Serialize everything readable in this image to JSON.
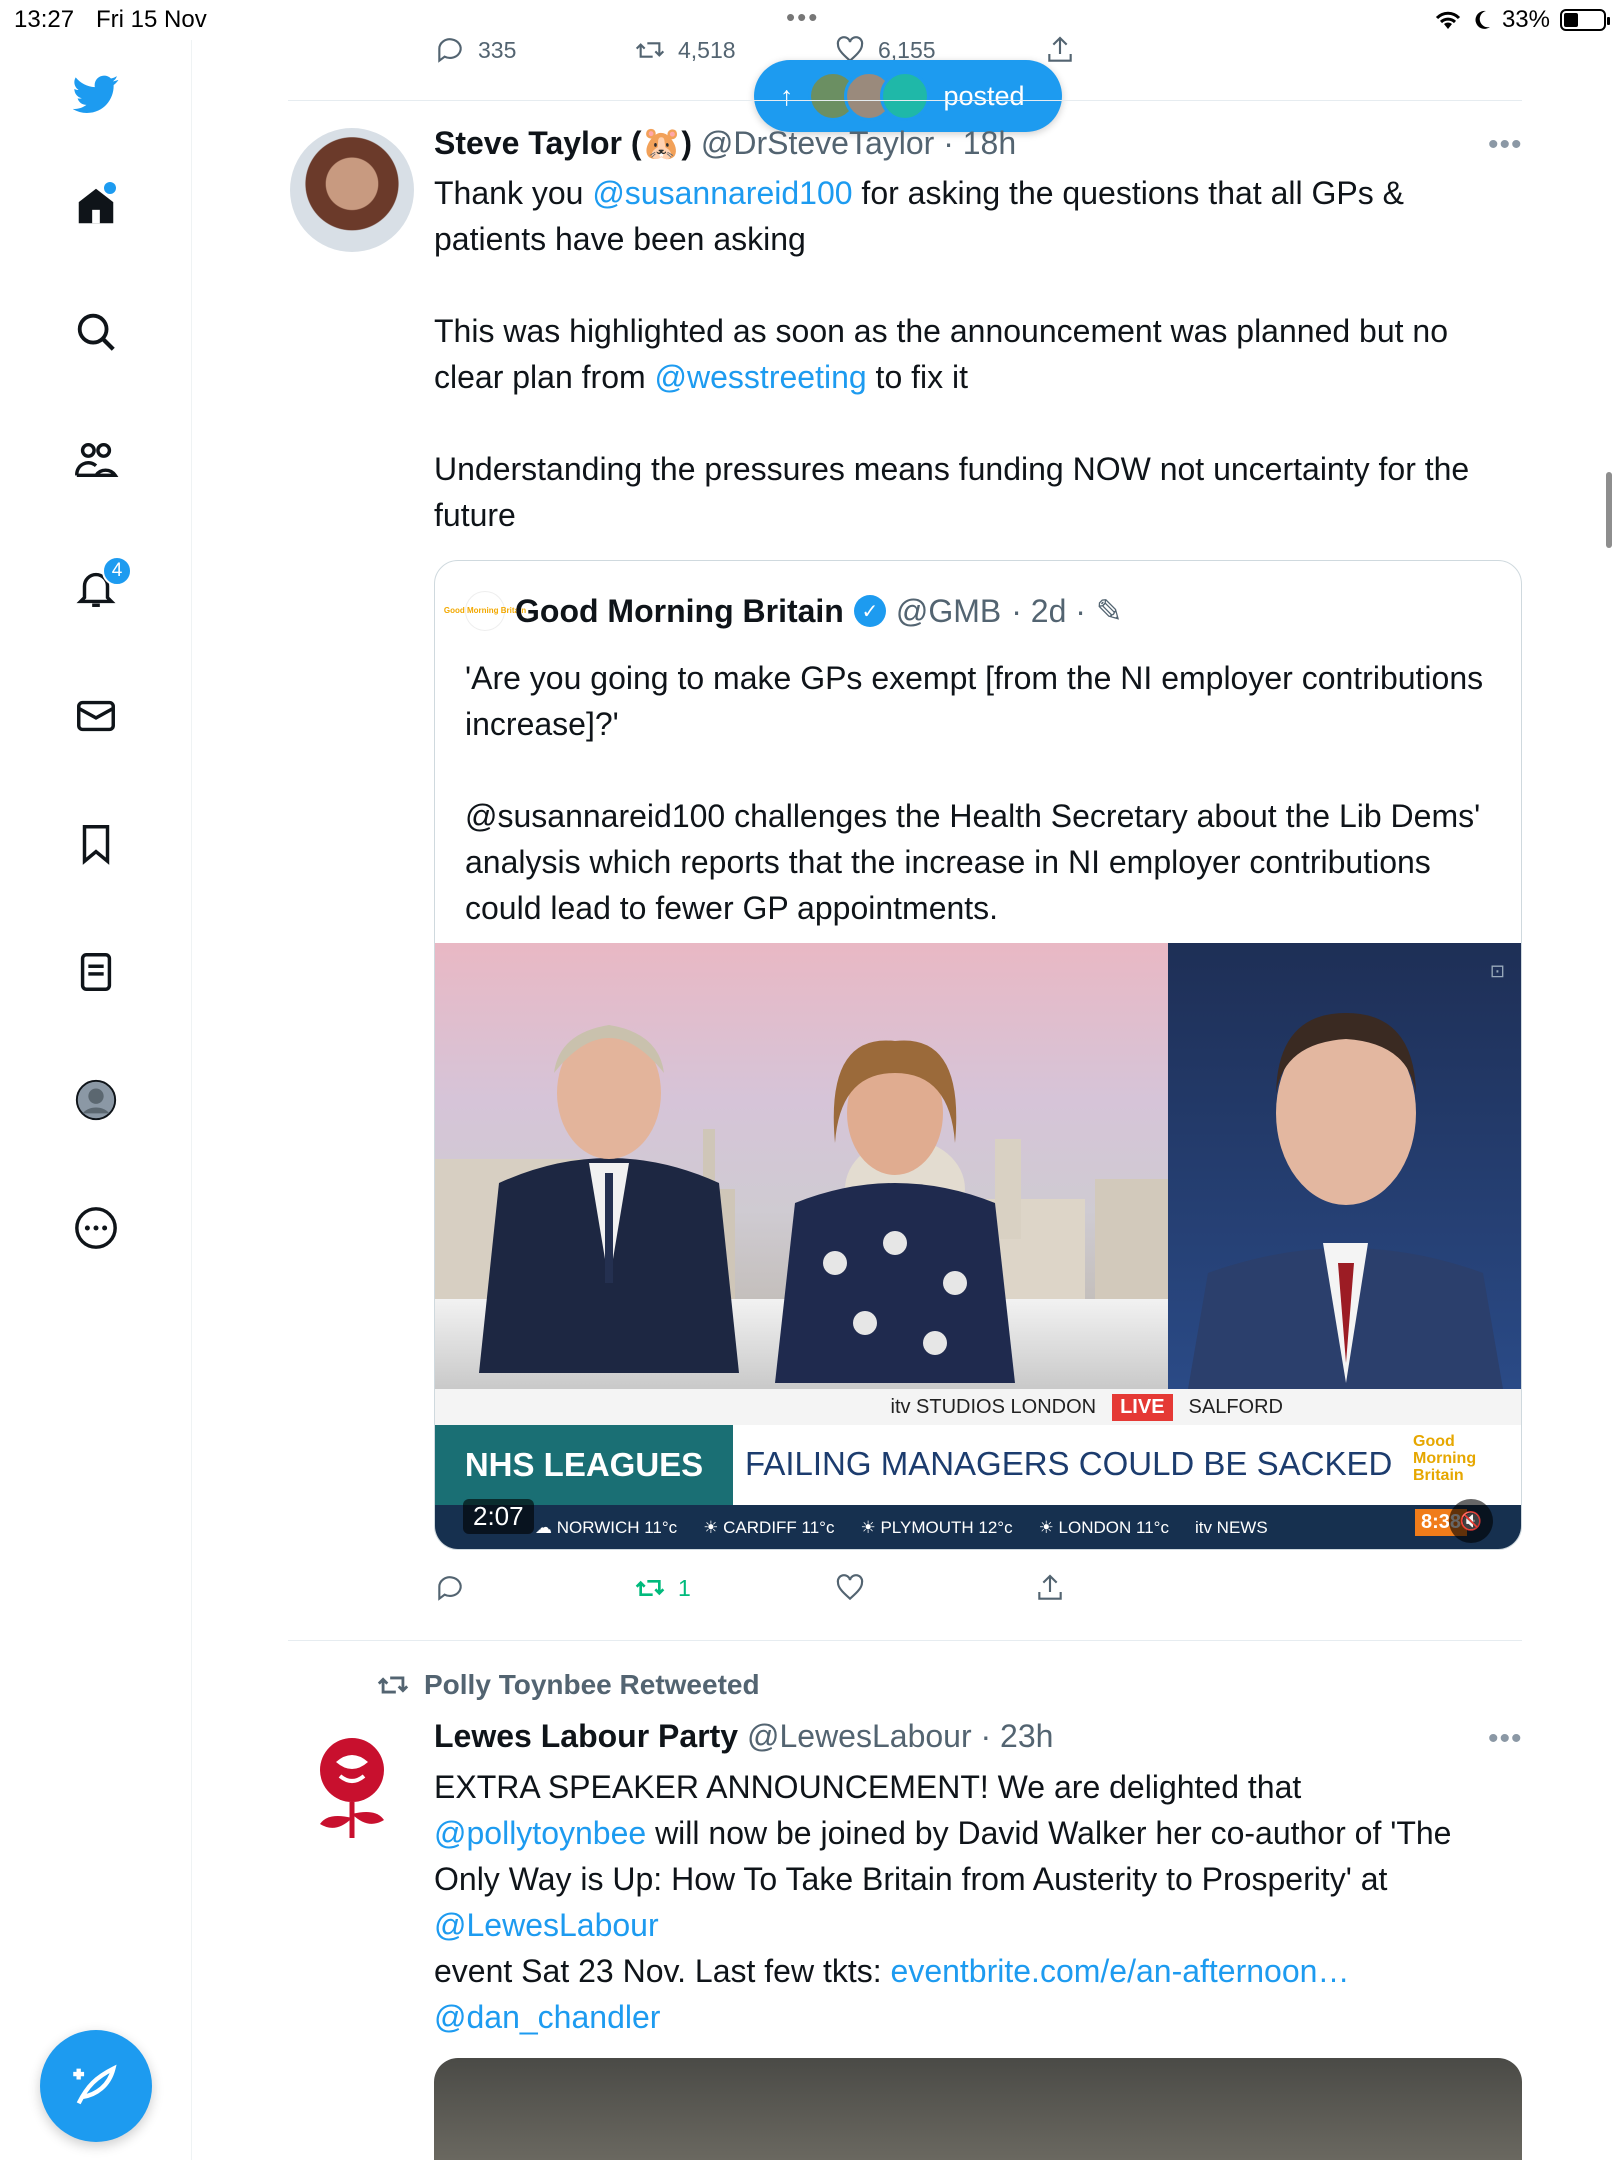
{
  "status_bar": {
    "time": "13:27",
    "date": "Fri 15 Nov",
    "battery": "33%",
    "battery_level": 0.33
  },
  "top_actions": {
    "replies": "335",
    "retweets": "4,518",
    "likes": "6,155"
  },
  "posted_pill": {
    "label": "posted"
  },
  "sidebar": {
    "notifications_count": "4"
  },
  "tweet1": {
    "name": "Steve Taylor (🐹)",
    "handle": "@DrSteveTaylor",
    "time": "· 18h",
    "text_p1_a": "Thank you ",
    "text_p1_mention": "@susannareid100",
    "text_p1_b": " for asking the questions that all GPs & patients have been asking",
    "text_p2_a": "This was highlighted as soon as the announcement was planned but no clear plan from ",
    "text_p2_mention": "@wesstreeting",
    "text_p2_b": " to fix it",
    "text_p3": "Understanding the pressures means funding NOW not uncertainty for the future",
    "quote": {
      "logo_text": "Good Morning Britain",
      "name": "Good Morning Britain",
      "handle": "@GMB",
      "time": "· 2d ·",
      "text_p1": "'Are you going to make GPs exempt [from the NI employer contributions increase]?'",
      "text_p2": "@susannareid100 challenges the Health Secretary about the Lib Dems' analysis which reports that the increase in NI employer contributions could lead to fewer GP appointments.",
      "video": {
        "studios": "itv STUDIOS LONDON",
        "live": "LIVE",
        "salford": "SALFORD",
        "nhs_leagues": "NHS LEAGUES",
        "headline": "FAILING MANAGERS COULD BE SACKED",
        "gmb_logo": "Good Morning Britain",
        "duration": "2:07",
        "clock": "8:38",
        "weather": [
          "☁ NORWICH 11°c",
          "☀ CARDIFF 11°c",
          "☀ PLYMOUTH 12°c",
          "☀ LONDON 11°c",
          "itv NEWS"
        ]
      }
    },
    "actions": {
      "replies": "",
      "retweets": "1",
      "likes": ""
    }
  },
  "tweet2": {
    "retweeted_by": "Polly Toynbee Retweeted",
    "name": "Lewes Labour Party",
    "handle": "@LewesLabour",
    "time": "· 23h",
    "text_a": "EXTRA SPEAKER ANNOUNCEMENT! We are delighted that ",
    "mention1": "@pollytoynbee",
    "text_b": " will now be joined by David Walker her co-author of 'The Only Way is Up:  How To Take Britain from Austerity to Prosperity' at ",
    "mention2": "@LewesLabour",
    "text_c": "event Sat 23 Nov. Last few tkts: ",
    "link": "eventbrite.com/e/an-afternoon…",
    "mention3": "@dan_chandler"
  },
  "colors": {
    "accent": "#1d9bf0",
    "retweet_green": "#00ba7c",
    "text": "#0f1419",
    "secondary": "#536471"
  }
}
